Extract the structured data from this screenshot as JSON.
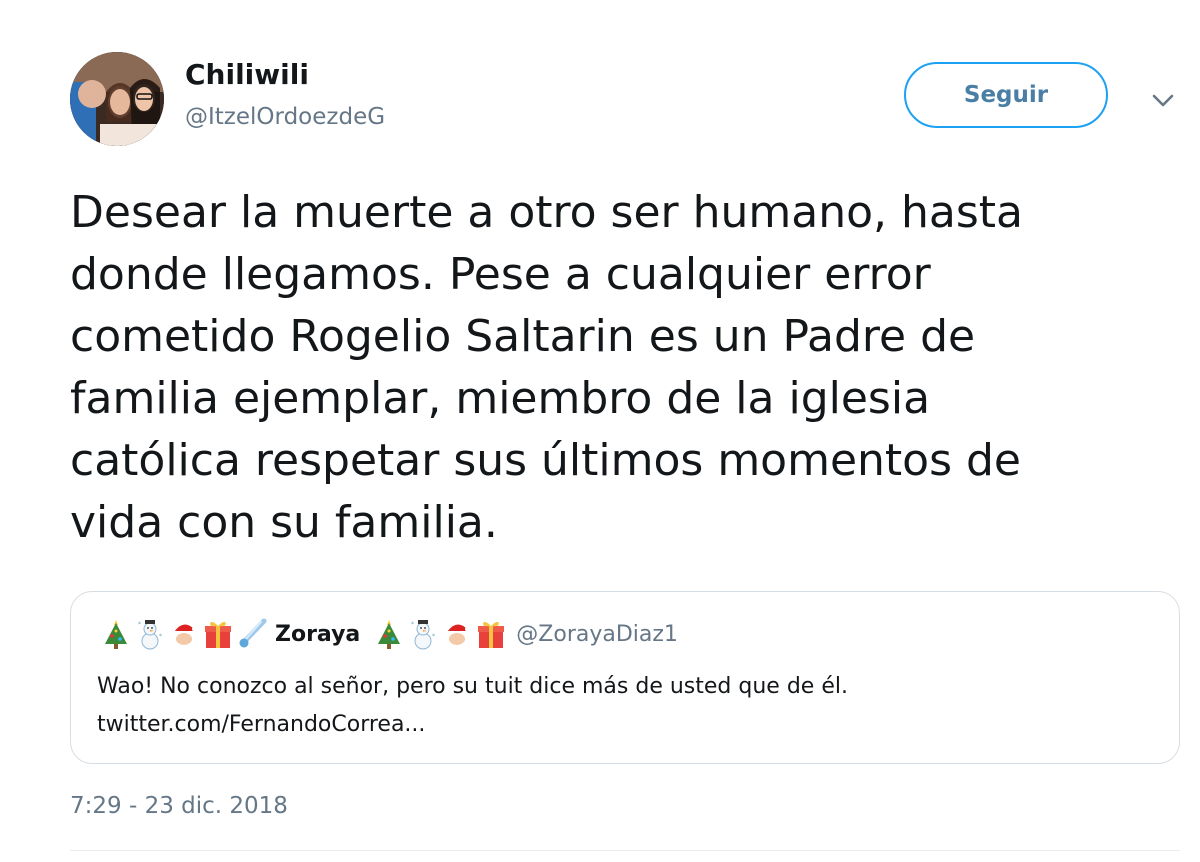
{
  "author": {
    "display_name": "Chiliwili",
    "handle": "@ItzelOrdoezdeG"
  },
  "follow_button": {
    "label": "Seguir"
  },
  "menu": {
    "icon": "chevron-down-icon"
  },
  "tweet": {
    "text": "Desear la muerte a otro ser humano, hasta\ndonde llegamos.  Pese a cualquier error\ncometido Rogelio Saltarin es un Padre de\nfamilia ejemplar, miembro de la iglesia\ncatólica respetar sus últimos momentos de\nvida con su familia.",
    "timestamp": "7:29 - 23 dic. 2018"
  },
  "quoted_tweet": {
    "name": "Zoraya",
    "handle": "@ZorayaDiaz1",
    "name_prefix_emojis": [
      "christmas-tree-icon",
      "snowman-icon",
      "santa-icon",
      "gift-icon",
      "comet-icon"
    ],
    "name_suffix_emojis": [
      "christmas-tree-icon",
      "snowman-icon",
      "santa-icon",
      "gift-icon"
    ],
    "text": "Wao! No conozco al señor, pero su tuit dice más de usted que de él.\ntwitter.com/FernandoCorrea..."
  },
  "colors": {
    "accent": "#1da1f2",
    "secondary_text": "#657786",
    "primary_text": "#14171a",
    "border": "#d6dde3"
  }
}
